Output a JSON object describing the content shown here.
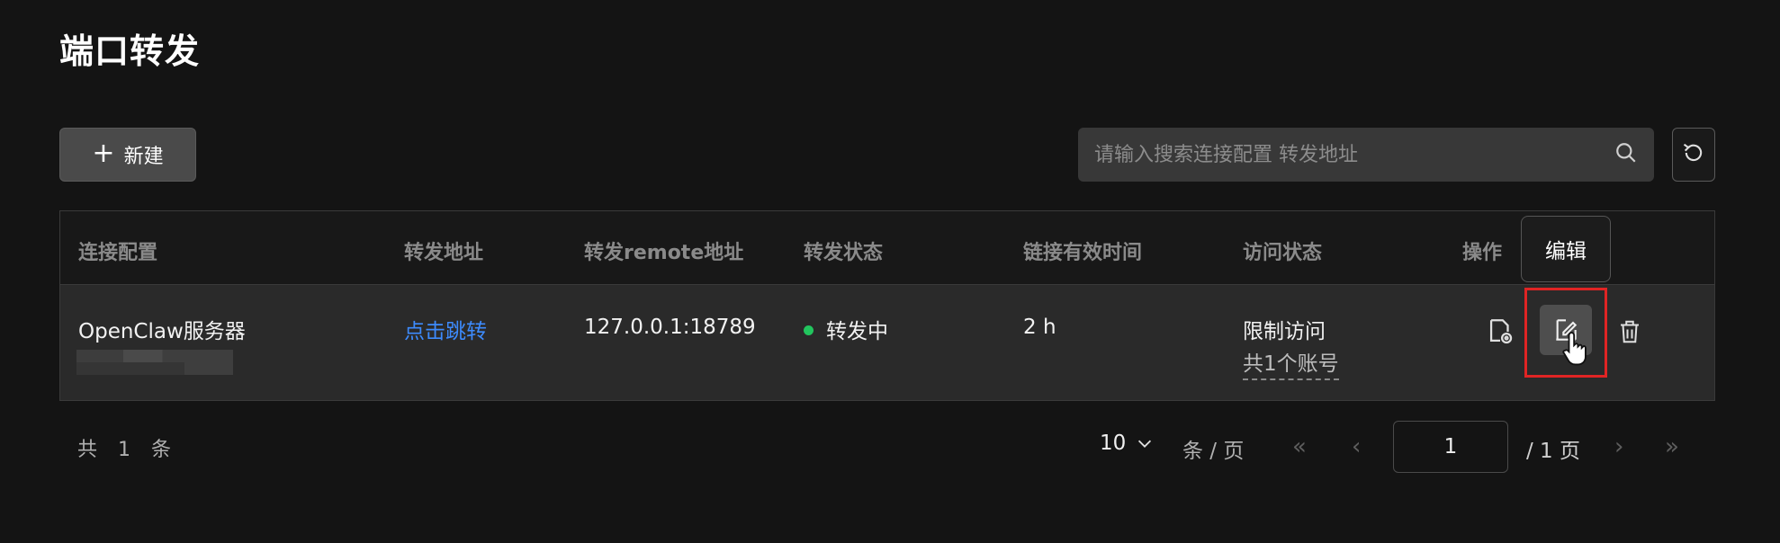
{
  "page": {
    "title": "端口转发"
  },
  "toolbar": {
    "new_label": "新建",
    "search_placeholder": "请输入搜索连接配置 转发地址"
  },
  "table": {
    "columns": [
      "连接配置",
      "转发地址",
      "转发remote地址",
      "转发状态",
      "链接有效时间",
      "访问状态",
      "操作"
    ],
    "rows": [
      {
        "config_name": "OpenClaw服务器",
        "forward_link": "点击跳转",
        "remote_address": "127.0.0.1:18789",
        "status": "转发中",
        "valid_time": "2 h",
        "access_state": "限制访问",
        "access_accounts": "共1个账号"
      }
    ]
  },
  "tooltip": {
    "text": "编辑"
  },
  "pagination": {
    "total_text": "共 1 条",
    "page_size": "10",
    "page_size_suffix": "条 / 页",
    "current_page": "1",
    "total_pages_text": "/ 1 页"
  },
  "colors": {
    "accent_link": "#3d8bfd",
    "status_active": "#22c55e",
    "highlight": "#e02424"
  }
}
